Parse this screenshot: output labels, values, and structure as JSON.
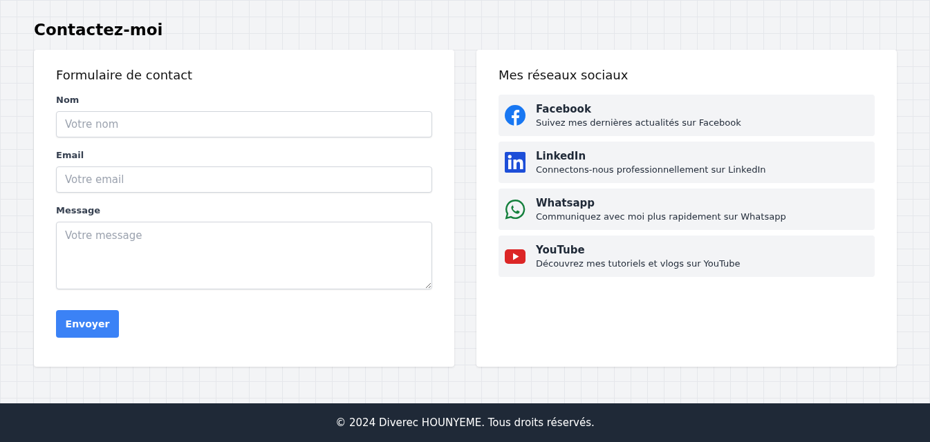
{
  "page": {
    "title": "Contactez-moi"
  },
  "contact_form": {
    "title": "Formulaire de contact",
    "fields": [
      {
        "label": "Nom",
        "placeholder": "Votre nom",
        "kind": "text"
      },
      {
        "label": "Email",
        "placeholder": "Votre email",
        "kind": "text"
      },
      {
        "label": "Message",
        "placeholder": "Votre message",
        "kind": "textarea"
      }
    ],
    "submit_button": "Envoyer"
  },
  "social": {
    "title": "Mes réseaux sociaux",
    "items": [
      {
        "kind": "facebook",
        "name": "Facebook",
        "description": "Suivez mes dernières actualités sur Facebook"
      },
      {
        "kind": "linkedin",
        "name": "LinkedIn",
        "description": "Connectons-nous professionnellement sur LinkedIn"
      },
      {
        "kind": "whatsapp",
        "name": "Whatsapp",
        "description": "Communiquez avec moi plus rapidement sur Whatsapp"
      },
      {
        "kind": "youtube",
        "name": "YouTube",
        "description": "Découvrez mes tutoriels et vlogs sur YouTube"
      }
    ]
  },
  "footer": {
    "text": "© 2024 Diverec HOUNYEME. Tous droits réservés."
  }
}
